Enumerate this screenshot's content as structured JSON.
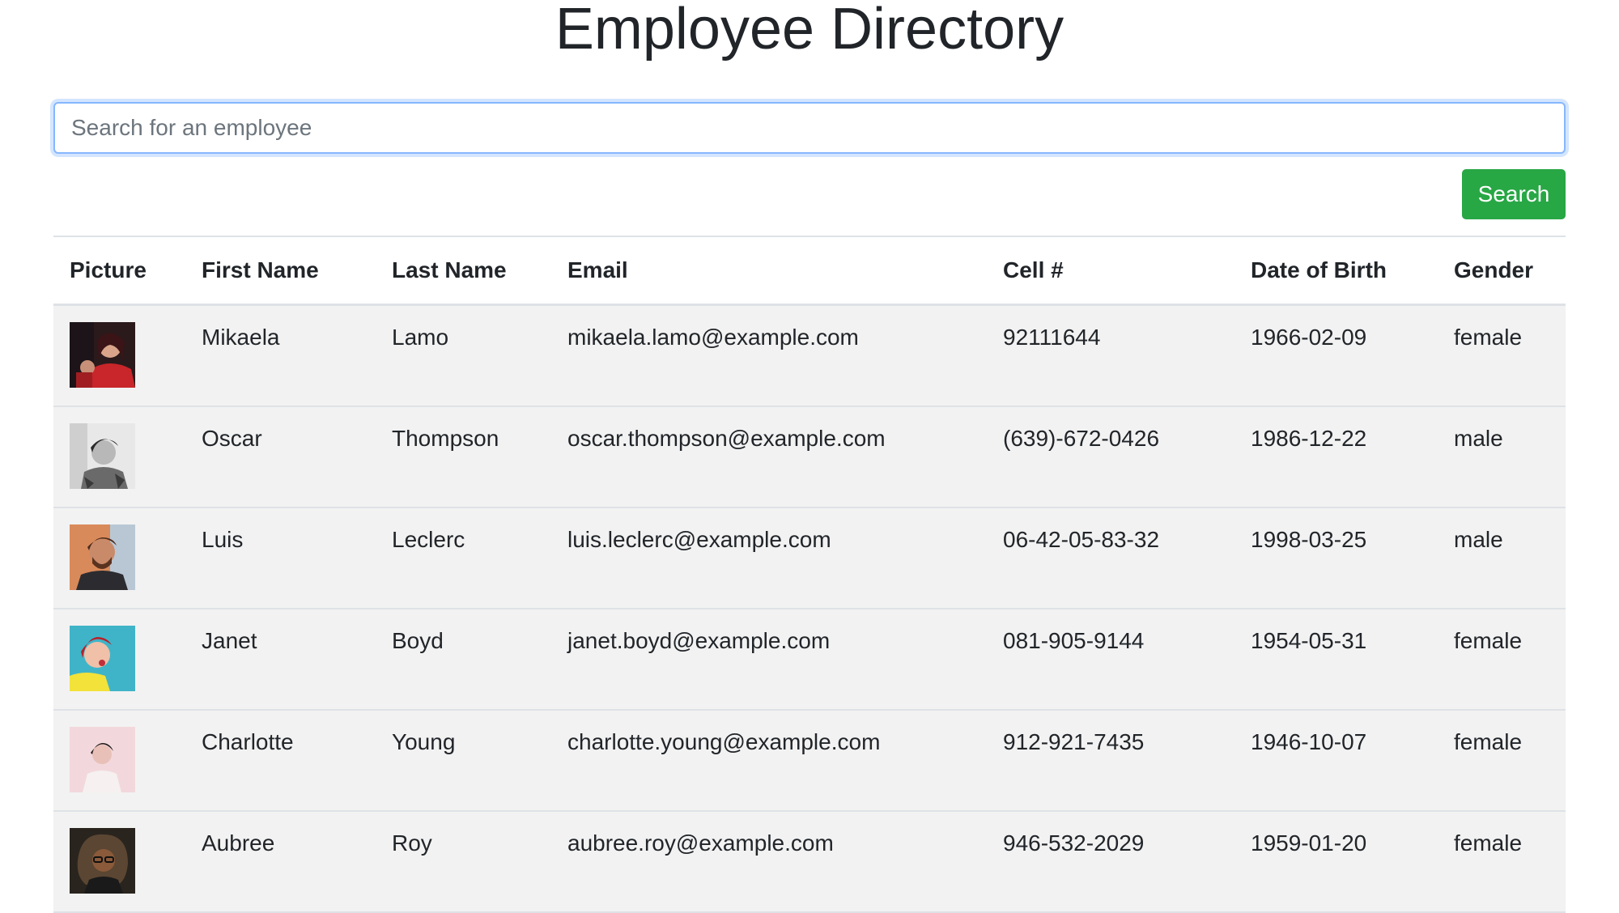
{
  "page": {
    "title": "Employee Directory"
  },
  "search": {
    "placeholder": "Search for an employee",
    "value": "",
    "button_label": "Search"
  },
  "colors": {
    "search_button": "#28a745",
    "row_background": "#f2f2f2",
    "focus_border": "#86b7fe"
  },
  "table": {
    "headers": [
      "Picture",
      "First Name",
      "Last Name",
      "Email",
      "Cell #",
      "Date of Birth",
      "Gender"
    ],
    "rows": [
      {
        "picture": "employee-photo-mikaela",
        "first": "Mikaela",
        "last": "Lamo",
        "email": "mikaela.lamo@example.com",
        "cell": "92111644",
        "dob": "1966-02-09",
        "gender": "female"
      },
      {
        "picture": "employee-photo-oscar",
        "first": "Oscar",
        "last": "Thompson",
        "email": "oscar.thompson@example.com",
        "cell": "(639)-672-0426",
        "dob": "1986-12-22",
        "gender": "male"
      },
      {
        "picture": "employee-photo-luis",
        "first": "Luis",
        "last": "Leclerc",
        "email": "luis.leclerc@example.com",
        "cell": "06-42-05-83-32",
        "dob": "1998-03-25",
        "gender": "male"
      },
      {
        "picture": "employee-photo-janet",
        "first": "Janet",
        "last": "Boyd",
        "email": "janet.boyd@example.com",
        "cell": "081-905-9144",
        "dob": "1954-05-31",
        "gender": "female"
      },
      {
        "picture": "employee-photo-charlotte",
        "first": "Charlotte",
        "last": "Young",
        "email": "charlotte.young@example.com",
        "cell": "912-921-7435",
        "dob": "1946-10-07",
        "gender": "female"
      },
      {
        "picture": "employee-photo-aubree",
        "first": "Aubree",
        "last": "Roy",
        "email": "aubree.roy@example.com",
        "cell": "946-532-2029",
        "dob": "1959-01-20",
        "gender": "female"
      }
    ]
  }
}
